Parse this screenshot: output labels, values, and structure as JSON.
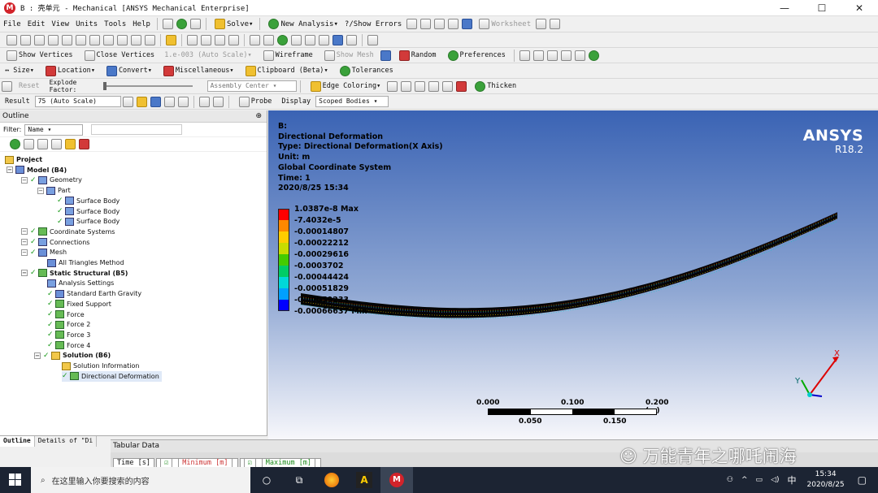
{
  "window": {
    "title": "B : 壳单元 - Mechanical [ANSYS Mechanical Enterprise]",
    "app_icon": "M"
  },
  "menubar": {
    "items": [
      "File",
      "Edit",
      "View",
      "Units",
      "Tools",
      "Help"
    ],
    "solve": "Solve",
    "new_analysis": "New Analysis",
    "show_errors": "?/Show Errors",
    "worksheet": "Worksheet"
  },
  "toolbar3": {
    "show_vertices": "Show Vertices",
    "close_vertices": "Close Vertices",
    "scale_value": "1.e-003 (Auto Scale)",
    "wireframe": "Wireframe",
    "show_mesh": "Show Mesh",
    "random": "Random",
    "preferences": "Preferences"
  },
  "toolbar4": {
    "size": "Size",
    "location": "Location",
    "convert": "Convert",
    "misc": "Miscellaneous",
    "clipboard": "Clipboard (Beta)",
    "tolerances": "Tolerances"
  },
  "toolbar5": {
    "reset": "Reset",
    "explode_factor": "Explode Factor:",
    "assembly_center": "Assembly Center",
    "edge_coloring": "Edge Coloring",
    "thicken": "Thicken"
  },
  "toolbar6": {
    "result_label": "Result",
    "result_scale": "75 (Auto Scale)",
    "probe": "Probe",
    "display_label": "Display",
    "display_value": "Scoped Bodies"
  },
  "outline": {
    "title": "Outline",
    "pin": "⊕",
    "filter_label": "Filter:",
    "filter_value": "Name",
    "tree": [
      {
        "label": "Project",
        "bold": true
      },
      {
        "label": "Model (B4)",
        "bold": true
      },
      {
        "label": "Geometry"
      },
      {
        "label": "Part"
      },
      {
        "label": "Surface Body"
      },
      {
        "label": "Surface Body"
      },
      {
        "label": "Surface Body"
      },
      {
        "label": "Coordinate Systems"
      },
      {
        "label": "Connections"
      },
      {
        "label": "Mesh"
      },
      {
        "label": "All Triangles Method"
      },
      {
        "label": "Static Structural (B5)",
        "bold": true
      },
      {
        "label": "Analysis Settings"
      },
      {
        "label": "Standard Earth Gravity"
      },
      {
        "label": "Fixed Support"
      },
      {
        "label": "Force"
      },
      {
        "label": "Force 2"
      },
      {
        "label": "Force 3"
      },
      {
        "label": "Force 4"
      },
      {
        "label": "Solution (B6)",
        "bold": true
      },
      {
        "label": "Solution Information"
      },
      {
        "label": "Directional Deformation"
      }
    ]
  },
  "bottom_tabs": [
    "Outline",
    "Details of \"Di"
  ],
  "viewport": {
    "info": [
      "B:",
      "Directional Deformation",
      "Type: Directional Deformation(X Axis)",
      "Unit: m",
      "Global Coordinate System",
      "Time: 1",
      "2020/8/25 15:34"
    ],
    "logo": "ANSYS",
    "version": "R18.2",
    "legend": {
      "labels": [
        "1.0387e-8 Max",
        "-7.4032e-5",
        "-0.00014807",
        "-0.00022212",
        "-0.00029616",
        "-0.0003702",
        "-0.00044424",
        "-0.00051829",
        "-0.00059233",
        "-0.00066637 Min"
      ],
      "colors": [
        "#ff0000",
        "#ff8800",
        "#ffcc00",
        "#c8dc00",
        "#44cc00",
        "#00cc66",
        "#00d8d8",
        "#00a0ff",
        "#0000ff"
      ]
    },
    "scale": {
      "top": [
        "0.000",
        "0.100",
        "0.200 (m)"
      ],
      "bottom": [
        "0.050",
        "0.150"
      ]
    },
    "triad": {
      "x": "X",
      "y": "Y"
    }
  },
  "tabular": {
    "title": "Tabular Data",
    "columns": [
      "Time [s]",
      "Minimum [m]",
      "Maximum [m]"
    ]
  },
  "watermark": "万能青年之哪吒闹海",
  "taskbar": {
    "search_placeholder": "在这里输入你要搜索的内容",
    "ime": "中",
    "time": "15:34",
    "date": "2020/8/25"
  }
}
